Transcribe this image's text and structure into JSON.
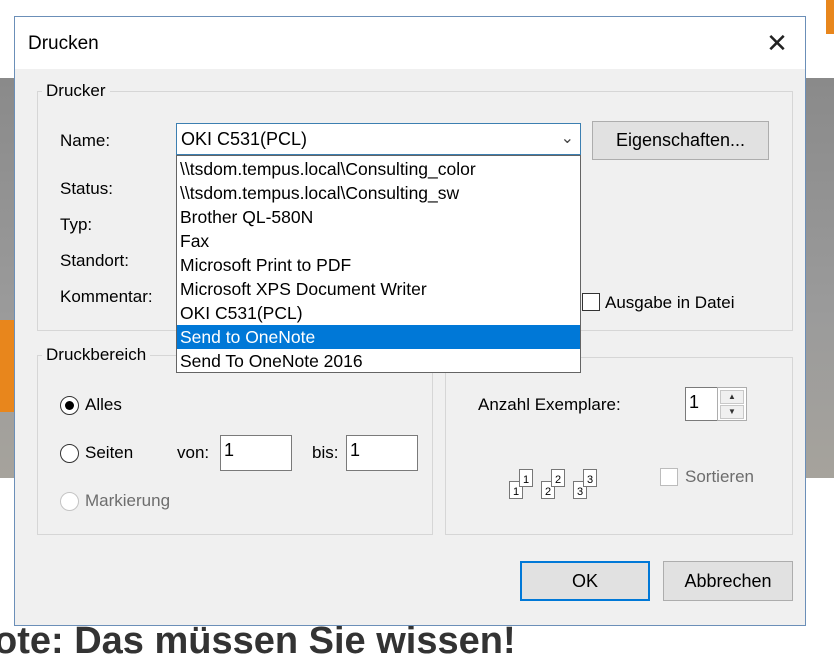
{
  "background": {
    "headline": "ote: Das müssen Sie wissen!"
  },
  "dialog": {
    "title": "Drucken",
    "printer_group": {
      "legend": "Drucker",
      "name_label": "Name:",
      "selected_printer": "OKI C531(PCL)",
      "properties_button": "Eigenschaften...",
      "status_label": "Status:",
      "type_label": "Typ:",
      "location_label": "Standort:",
      "comment_label": "Kommentar:",
      "print_to_file_label": "Ausgabe in Datei",
      "print_to_file_checked": false,
      "dropdown_items": [
        "\\\\tsdom.tempus.local\\Consulting_color",
        "\\\\tsdom.tempus.local\\Consulting_sw",
        "Brother QL-580N",
        "Fax",
        "Microsoft Print to PDF",
        "Microsoft XPS Document Writer",
        "OKI C531(PCL)",
        "Send to OneNote",
        "Send To OneNote 2016"
      ],
      "highlighted_item": "Send to OneNote"
    },
    "range_group": {
      "legend": "Druckbereich",
      "all_label": "Alles",
      "pages_label": "Seiten",
      "from_label": "von:",
      "from_value": "1",
      "to_label": "bis:",
      "to_value": "1",
      "selection_label": "Markierung",
      "selected_option": "Alles"
    },
    "copies_group": {
      "copies_label": "Anzahl Exemplare:",
      "copies_value": "1",
      "collate_label": "Sortieren",
      "collate_checked": false,
      "collate_pages": [
        "1",
        "1",
        "2",
        "2",
        "3",
        "3"
      ]
    },
    "ok_button": "OK",
    "cancel_button": "Abbrechen"
  },
  "colors": {
    "accent": "#0078d7",
    "dialog_bg": "#f0f0f0",
    "orange": "#e8861c"
  },
  "icons": {
    "close": "close-icon",
    "dropdown": "chevron-down-icon",
    "spin_up": "caret-up-icon",
    "spin_down": "caret-down-icon"
  }
}
